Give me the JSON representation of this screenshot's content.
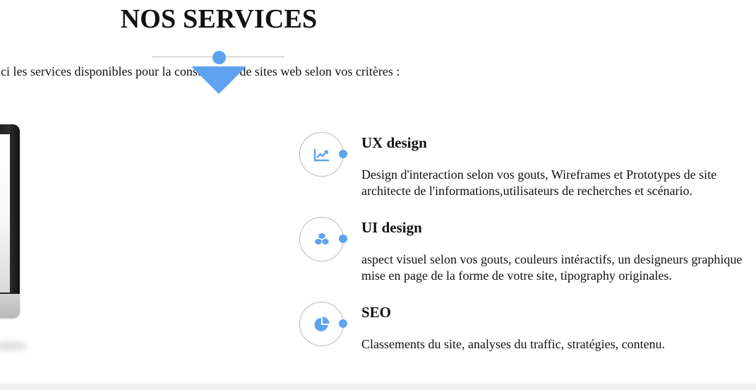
{
  "header": {
    "title": "NOS SERVICES",
    "intro": "ici les services disponibles pour la construtions de sites web selon vos critères :"
  },
  "services": [
    {
      "title": "UX design",
      "description_line1": "Design d'interaction selon vos gouts, Wireframes et Prototypes de site",
      "description_line2": "architecte de l'informations,utilisateurs de recherches et scénario.",
      "icon": "line-chart-icon"
    },
    {
      "title": "UI design",
      "description_line1": "aspect visuel selon vos gouts, couleurs intéractifs, un designeurs graphique",
      "description_line2": "mise en page de la forme de votre site, tipography originales.",
      "icon": "cubes-icon"
    },
    {
      "title": "SEO",
      "description_line1": "Classements du site, analyses du traffic, stratégies, contenu.",
      "icon": "pie-chart-icon"
    }
  ],
  "colors": {
    "accent": "#5fa2f2",
    "text": "#111111",
    "divider": "#b9b9b9",
    "footer_band": "#f1f1f1"
  }
}
